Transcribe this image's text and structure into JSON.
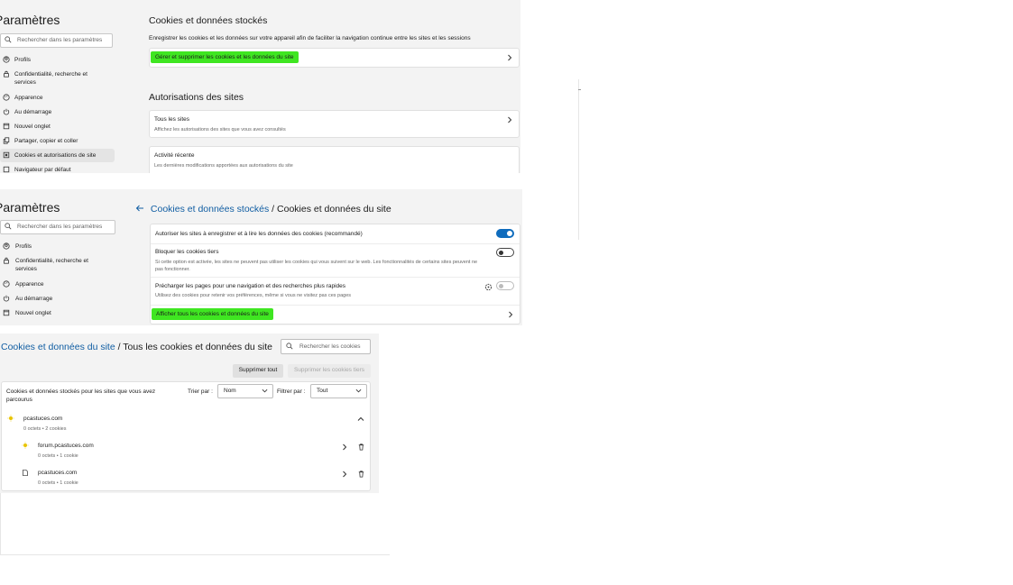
{
  "sidebar": {
    "title": "Paramètres",
    "search_placeholder": "Rechercher dans les paramètres",
    "items": [
      {
        "label": "Profils"
      },
      {
        "label": "Confidentialité, recherche et services"
      },
      {
        "label": "Apparence"
      },
      {
        "label": "Au démarrage"
      },
      {
        "label": "Nouvel onglet"
      },
      {
        "label": "Partager, copier et coller"
      },
      {
        "label": "Cookies et autorisations de site"
      },
      {
        "label": "Navigateur par défaut"
      }
    ]
  },
  "panel1": {
    "section1_title": "Cookies et données stockés",
    "section1_desc": "Enregistrer les cookies et les données sur votre appareil afin de faciliter la navigation continue entre les sites et les sessions",
    "manage_link": "Gérer et supprimer les cookies et les données du site",
    "section2_title": "Autorisations des sites",
    "all_sites_title": "Tous les sites",
    "all_sites_desc": "Affichez les autorisations des sites que vous avez consultés",
    "recent_title": "Activité récente",
    "recent_desc": "Les dernières modifications apportées aux autorisations du site"
  },
  "panel2": {
    "breadcrumb_parent": "Cookies et données stockés",
    "breadcrumb_sep": " / ",
    "breadcrumb_current": "Cookies et données du site",
    "allow_label": "Autoriser les sites à enregistrer et à lire les données des cookies (recommandé)",
    "block_label": "Bloquer les cookies tiers",
    "block_desc": "Si cette option est activée, les sites ne peuvent pas utiliser les cookies qui vous suivent sur le web. Les fonctionnalités de certains sites peuvent ne pas fonctionner.",
    "preload_label": "Précharger les pages pour une navigation et des recherches plus rapides",
    "preload_desc": "Utilisez des cookies pour retenir vos préférences, même si vous ne visitez pas ces pages",
    "show_all_link": "Afficher tous les cookies et données du site"
  },
  "panel3": {
    "breadcrumb_parent": "Cookies et données du site",
    "breadcrumb_sep": " / ",
    "breadcrumb_current": "Tous les cookies et données du site",
    "search_placeholder": "Rechercher les cookies",
    "delete_all": "Supprimer tout",
    "delete_third": "Supprimer les cookies tiers",
    "list_header": "Cookies et données stockés pour les sites que vous avez parcourus",
    "sort_label": "Trier par :",
    "sort_value": "Nom",
    "filter_label": "Filtrer par :",
    "filter_value": "Tout",
    "site_main": {
      "name": "pcastuces.com",
      "meta": "0 octets • 2 cookies"
    },
    "sub_sites": [
      {
        "name": "forum.pcastuces.com",
        "meta": "0 octets • 1 cookie"
      },
      {
        "name": "pcastuces.com",
        "meta": "0 octets • 1 cookie"
      }
    ]
  },
  "colors": {
    "accent": "#0f6cbd",
    "highlight": "#3fe621",
    "link": "#115ea3"
  }
}
